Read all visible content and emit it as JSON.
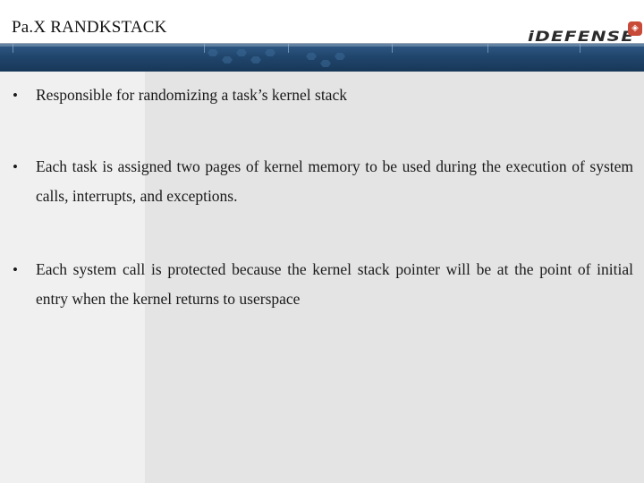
{
  "slide": {
    "title": "Pa.X RANDKSTACK",
    "logo": {
      "text": "iDEFENSE",
      "badge_icon": "shield-badge"
    },
    "bullets": [
      {
        "marker": "•",
        "text": "Responsible for randomizing a task’s kernel stack"
      },
      {
        "marker": "•",
        "text": "Each task is assigned two pages of kernel memory to be used during the execution of system calls, interrupts, and exceptions."
      },
      {
        "marker": "•",
        "text": "Each system call is protected because the kernel stack pointer will be at the point of initial entry when the kernel returns to userspace"
      }
    ]
  },
  "colors": {
    "banner": "#21466d",
    "background_left": "#f0f0f0",
    "background_right": "#e4e4e4",
    "logo_badge": "#c84a38"
  }
}
